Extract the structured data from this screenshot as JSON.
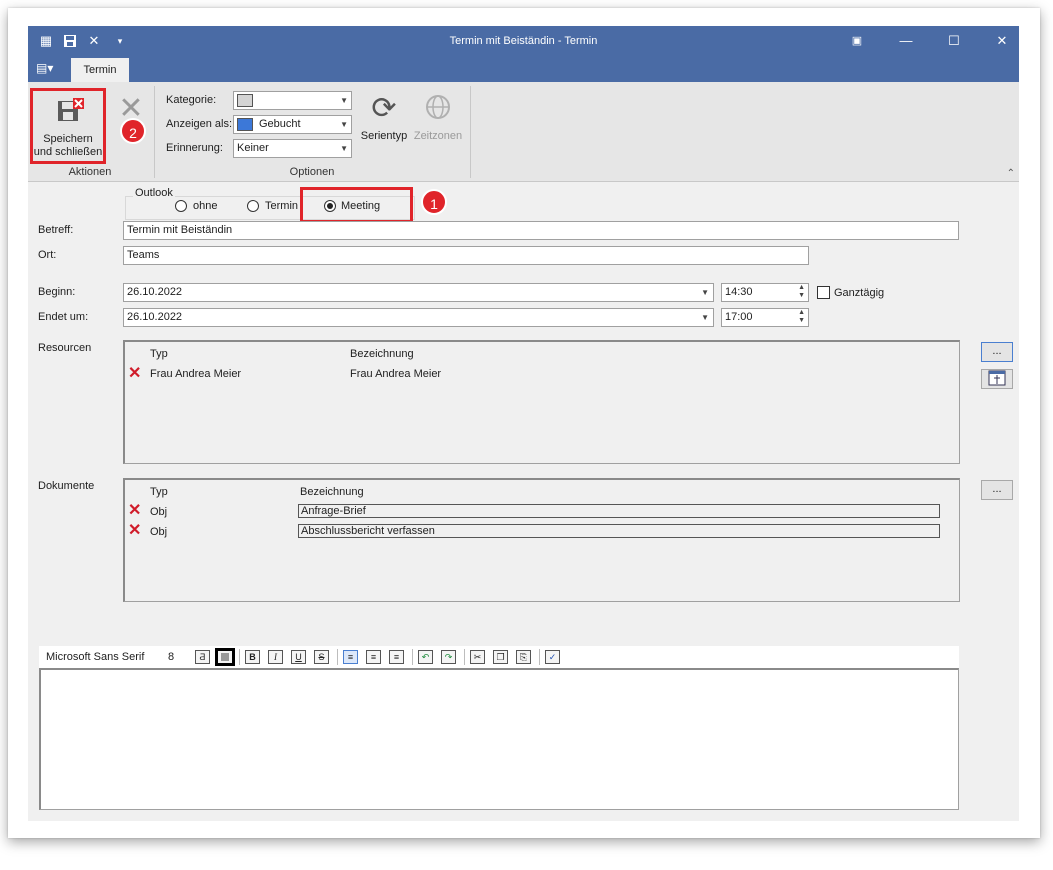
{
  "window": {
    "title": "Termin mit Beiständin - Termin",
    "tab": "Termin"
  },
  "ribbon": {
    "save_close_label": "Speichern und schließen",
    "delete_label": "Löschen",
    "group_actions": "Aktionen",
    "group_options": "Optionen",
    "kategorie_label": "Kategorie:",
    "kategorie_value": "",
    "anzeigen_label": "Anzeigen als:",
    "anzeigen_value": "Gebucht",
    "anzeigen_color": "#3c78d8",
    "erinnerung_label": "Erinnerung:",
    "erinnerung_value": "Keiner",
    "serientyp_label": "Serientyp",
    "zeitzonen_label": "Zeitzonen"
  },
  "outlook": {
    "group_label": "Outlook",
    "options": [
      "ohne",
      "Termin",
      "Meeting"
    ],
    "selected": "Meeting"
  },
  "callouts": {
    "one": "1",
    "two": "2"
  },
  "form": {
    "betreff_label": "Betreff:",
    "betreff_value": "Termin mit Beiständin",
    "ort_label": "Ort:",
    "ort_value": "Teams",
    "beginn_label": "Beginn:",
    "beginn_date": "26.10.2022",
    "beginn_time": "14:30",
    "ende_label": "Endet um:",
    "ende_date": "26.10.2022",
    "ende_time": "17:00",
    "ganztaegig_label": "Ganztägig"
  },
  "resources": {
    "label": "Resourcen",
    "col_typ": "Typ",
    "col_bez": "Bezeichnung",
    "rows": [
      {
        "typ": "Frau Andrea Meier",
        "bez": "Frau Andrea Meier"
      }
    ],
    "button_label": "..."
  },
  "documents": {
    "label": "Dokumente",
    "col_typ": "Typ",
    "col_bez": "Bezeichnung",
    "rows": [
      {
        "typ": "Obj",
        "bez": "Anfrage-Brief"
      },
      {
        "typ": "Obj",
        "bez": "Abschlussbericht verfassen"
      }
    ],
    "button_label": "..."
  },
  "editor": {
    "font_name": "Microsoft Sans Serif",
    "font_size": "8"
  },
  "colors": {
    "accent": "#4a6ba5",
    "highlight": "#e0242a"
  }
}
